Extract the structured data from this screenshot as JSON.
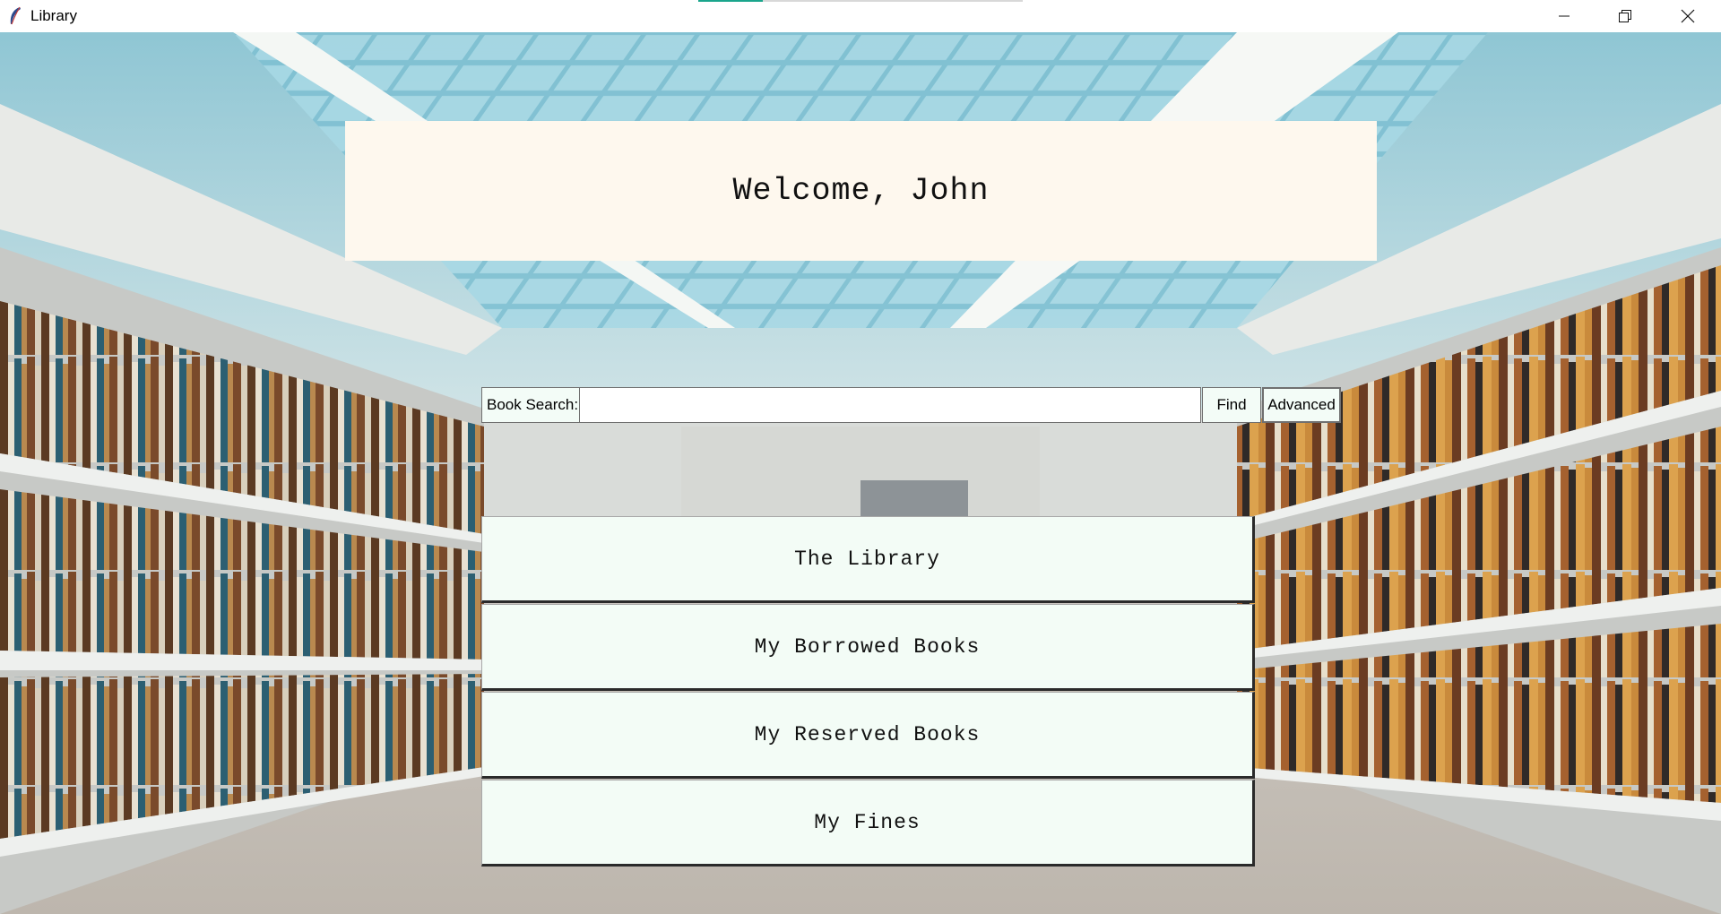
{
  "window": {
    "title": "Library",
    "app_icon": "feather-icon",
    "controls": {
      "minimize_icon": "minimize-icon",
      "maximize_icon": "restore-icon",
      "close_icon": "close-icon"
    }
  },
  "welcome": {
    "text": "Welcome, John"
  },
  "search": {
    "label": "Book Search:",
    "value": "",
    "placeholder": "",
    "find_label": "Find",
    "advanced_label": "Advanced"
  },
  "menu": {
    "items": [
      {
        "label": "The Library"
      },
      {
        "label": "My Borrowed Books"
      },
      {
        "label": "My Reserved Books"
      },
      {
        "label": "My Fines"
      }
    ]
  },
  "colors": {
    "banner_bg": "#fef8ee",
    "button_bg": "#f3fcf6",
    "accent": "#1aa58c"
  }
}
